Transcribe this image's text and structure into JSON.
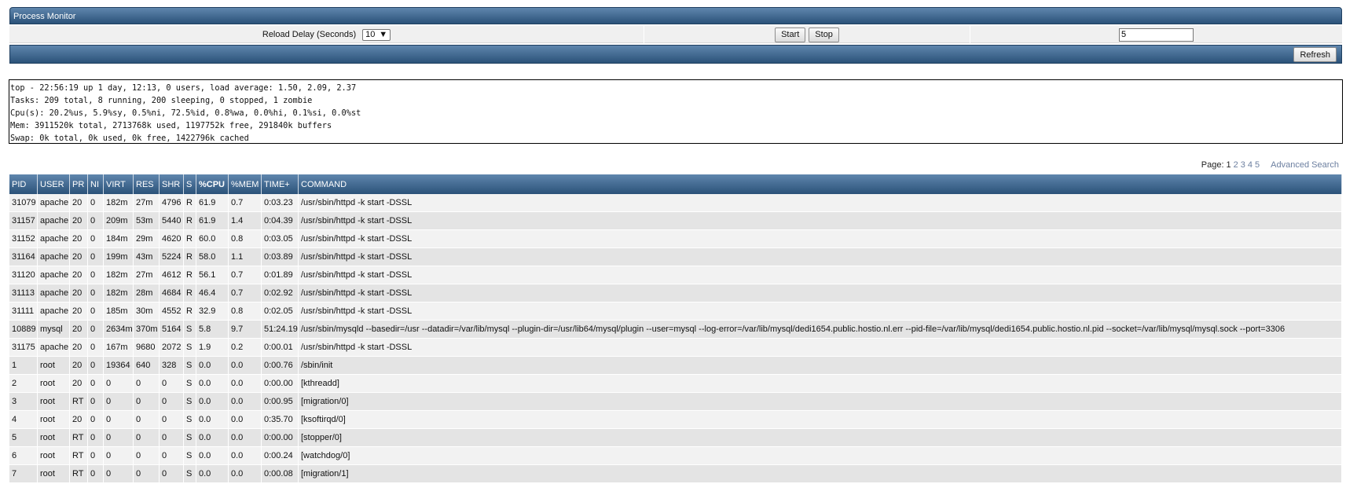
{
  "window": {
    "title": "Process Monitor"
  },
  "controls": {
    "reload_label": "Reload Delay (Seconds)",
    "reload_value": "10",
    "start_label": "Start",
    "stop_label": "Stop",
    "count_value": "5"
  },
  "toolbar": {
    "refresh_label": "Refresh"
  },
  "summary_lines": [
    "top - 22:56:19 up 1 day, 12:13, 0 users, load average: 1.50, 2.09, 2.37",
    "Tasks: 209 total, 8 running, 200 sleeping, 0 stopped, 1 zombie",
    "Cpu(s): 20.2%us, 5.9%sy, 0.5%ni, 72.5%id, 0.8%wa, 0.0%hi, 0.1%si, 0.0%st",
    "Mem: 3911520k total, 2713768k used, 1197752k free, 291840k buffers",
    "Swap: 0k total, 0k used, 0k free, 1422796k cached"
  ],
  "pager": {
    "label": "Page:",
    "pages": [
      "1",
      "2",
      "3",
      "4",
      "5"
    ],
    "current": "1",
    "advanced_search": "Advanced Search"
  },
  "table": {
    "columns": [
      "PID",
      "USER",
      "PR",
      "NI",
      "VIRT",
      "RES",
      "SHR",
      "S",
      "%CPU",
      "%MEM",
      "TIME+",
      "COMMAND"
    ],
    "sorted_column": "%CPU",
    "rows": [
      [
        "31079",
        "apache",
        "20",
        "0",
        "182m",
        "27m",
        "4796",
        "R",
        "61.9",
        "0.7",
        "0:03.23",
        "/usr/sbin/httpd -k start -DSSL"
      ],
      [
        "31157",
        "apache",
        "20",
        "0",
        "209m",
        "53m",
        "5440",
        "R",
        "61.9",
        "1.4",
        "0:04.39",
        "/usr/sbin/httpd -k start -DSSL"
      ],
      [
        "31152",
        "apache",
        "20",
        "0",
        "184m",
        "29m",
        "4620",
        "R",
        "60.0",
        "0.8",
        "0:03.05",
        "/usr/sbin/httpd -k start -DSSL"
      ],
      [
        "31164",
        "apache",
        "20",
        "0",
        "199m",
        "43m",
        "5224",
        "R",
        "58.0",
        "1.1",
        "0:03.89",
        "/usr/sbin/httpd -k start -DSSL"
      ],
      [
        "31120",
        "apache",
        "20",
        "0",
        "182m",
        "27m",
        "4612",
        "R",
        "56.1",
        "0.7",
        "0:01.89",
        "/usr/sbin/httpd -k start -DSSL"
      ],
      [
        "31113",
        "apache",
        "20",
        "0",
        "182m",
        "28m",
        "4684",
        "R",
        "46.4",
        "0.7",
        "0:02.92",
        "/usr/sbin/httpd -k start -DSSL"
      ],
      [
        "31111",
        "apache",
        "20",
        "0",
        "185m",
        "30m",
        "4552",
        "R",
        "32.9",
        "0.8",
        "0:02.05",
        "/usr/sbin/httpd -k start -DSSL"
      ],
      [
        "10889",
        "mysql",
        "20",
        "0",
        "2634m",
        "370m",
        "5164",
        "S",
        "5.8",
        "9.7",
        "51:24.19",
        "/usr/sbin/mysqld --basedir=/usr --datadir=/var/lib/mysql --plugin-dir=/usr/lib64/mysql/plugin --user=mysql --log-error=/var/lib/mysql/dedi1654.public.hostio.nl.err --pid-file=/var/lib/mysql/dedi1654.public.hostio.nl.pid --socket=/var/lib/mysql/mysql.sock --port=3306"
      ],
      [
        "31175",
        "apache",
        "20",
        "0",
        "167m",
        "9680",
        "2072",
        "S",
        "1.9",
        "0.2",
        "0:00.01",
        "/usr/sbin/httpd -k start -DSSL"
      ],
      [
        "1",
        "root",
        "20",
        "0",
        "19364",
        "640",
        "328",
        "S",
        "0.0",
        "0.0",
        "0:00.76",
        "/sbin/init"
      ],
      [
        "2",
        "root",
        "20",
        "0",
        "0",
        "0",
        "0",
        "S",
        "0.0",
        "0.0",
        "0:00.00",
        "[kthreadd]"
      ],
      [
        "3",
        "root",
        "RT",
        "0",
        "0",
        "0",
        "0",
        "S",
        "0.0",
        "0.0",
        "0:00.95",
        "[migration/0]"
      ],
      [
        "4",
        "root",
        "20",
        "0",
        "0",
        "0",
        "0",
        "S",
        "0.0",
        "0.0",
        "0:35.70",
        "[ksoftirqd/0]"
      ],
      [
        "5",
        "root",
        "RT",
        "0",
        "0",
        "0",
        "0",
        "S",
        "0.0",
        "0.0",
        "0:00.00",
        "[stopper/0]"
      ],
      [
        "6",
        "root",
        "RT",
        "0",
        "0",
        "0",
        "0",
        "S",
        "0.0",
        "0.0",
        "0:00.24",
        "[watchdog/0]"
      ],
      [
        "7",
        "root",
        "RT",
        "0",
        "0",
        "0",
        "0",
        "S",
        "0.0",
        "0.0",
        "0:00.08",
        "[migration/1]"
      ]
    ]
  },
  "colors": {
    "header_top": "#5f86ad",
    "header_bottom": "#2b5279",
    "row_odd": "#f2f2f2",
    "row_even": "#e4e4e4",
    "link": "#6c7fa0"
  }
}
